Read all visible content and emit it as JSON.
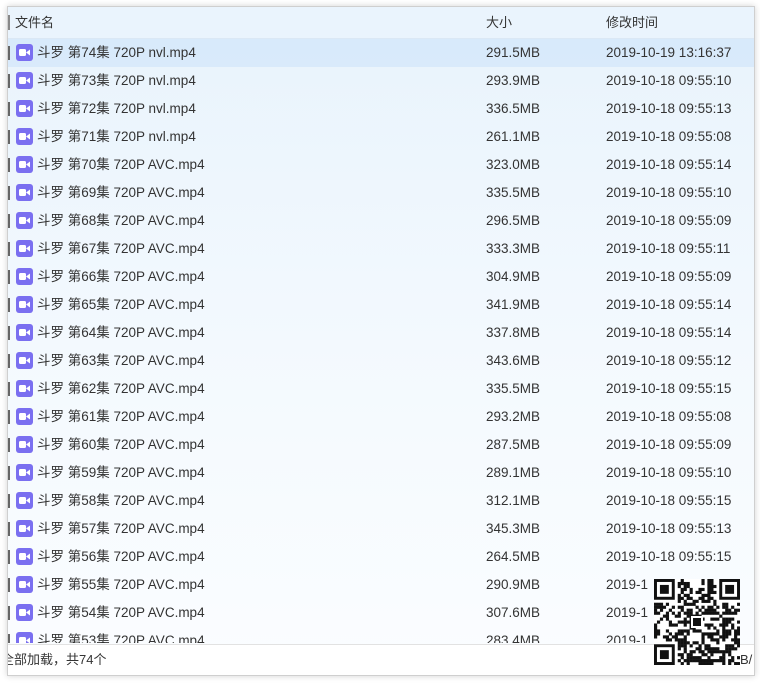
{
  "header": {
    "name_label": "文件名",
    "size_label": "大小",
    "time_label": "修改时间"
  },
  "files": [
    {
      "name": "斗罗 第74集 720P nvl.mp4",
      "size": "291.5MB",
      "time": "2019-10-19 13:16:37"
    },
    {
      "name": "斗罗 第73集 720P nvl.mp4",
      "size": "293.9MB",
      "time": "2019-10-18 09:55:10"
    },
    {
      "name": "斗罗 第72集 720P nvl.mp4",
      "size": "336.5MB",
      "time": "2019-10-18 09:55:13"
    },
    {
      "name": "斗罗 第71集 720P nvl.mp4",
      "size": "261.1MB",
      "time": "2019-10-18 09:55:08"
    },
    {
      "name": "斗罗 第70集 720P AVC.mp4",
      "size": "323.0MB",
      "time": "2019-10-18 09:55:14"
    },
    {
      "name": "斗罗 第69集 720P AVC.mp4",
      "size": "335.5MB",
      "time": "2019-10-18 09:55:10"
    },
    {
      "name": "斗罗 第68集 720P AVC.mp4",
      "size": "296.5MB",
      "time": "2019-10-18 09:55:09"
    },
    {
      "name": "斗罗 第67集 720P AVC.mp4",
      "size": "333.3MB",
      "time": "2019-10-18 09:55:11"
    },
    {
      "name": "斗罗 第66集 720P AVC.mp4",
      "size": "304.9MB",
      "time": "2019-10-18 09:55:09"
    },
    {
      "name": "斗罗 第65集 720P AVC.mp4",
      "size": "341.9MB",
      "time": "2019-10-18 09:55:14"
    },
    {
      "name": "斗罗 第64集 720P AVC.mp4",
      "size": "337.8MB",
      "time": "2019-10-18 09:55:14"
    },
    {
      "name": "斗罗 第63集 720P AVC.mp4",
      "size": "343.6MB",
      "time": "2019-10-18 09:55:12"
    },
    {
      "name": "斗罗 第62集 720P AVC.mp4",
      "size": "335.5MB",
      "time": "2019-10-18 09:55:15"
    },
    {
      "name": "斗罗 第61集 720P AVC.mp4",
      "size": "293.2MB",
      "time": "2019-10-18 09:55:08"
    },
    {
      "name": "斗罗 第60集 720P AVC.mp4",
      "size": "287.5MB",
      "time": "2019-10-18 09:55:09"
    },
    {
      "name": "斗罗 第59集 720P AVC.mp4",
      "size": "289.1MB",
      "time": "2019-10-18 09:55:10"
    },
    {
      "name": "斗罗 第58集 720P AVC.mp4",
      "size": "312.1MB",
      "time": "2019-10-18 09:55:15"
    },
    {
      "name": "斗罗 第57集 720P AVC.mp4",
      "size": "345.3MB",
      "time": "2019-10-18 09:55:13"
    },
    {
      "name": "斗罗 第56集 720P AVC.mp4",
      "size": "264.5MB",
      "time": "2019-10-18 09:55:15"
    },
    {
      "name": "斗罗 第55集 720P AVC.mp4",
      "size": "290.9MB",
      "time": "2019-1"
    },
    {
      "name": "斗罗 第54集 720P AVC.mp4",
      "size": "307.6MB",
      "time": "2019-1"
    },
    {
      "name": "斗罗 第53集 720P AVC.mp4",
      "size": "283.4MB",
      "time": "2019-1"
    }
  ],
  "status": {
    "text": "全部加载，共74个",
    "right_text": "B/"
  },
  "colors": {
    "video_icon": "#7a6ff0",
    "selected_row": "#cae2fa"
  },
  "icons": {
    "file_type": "video-file-icon",
    "corner_image": "qr-code-icon"
  }
}
